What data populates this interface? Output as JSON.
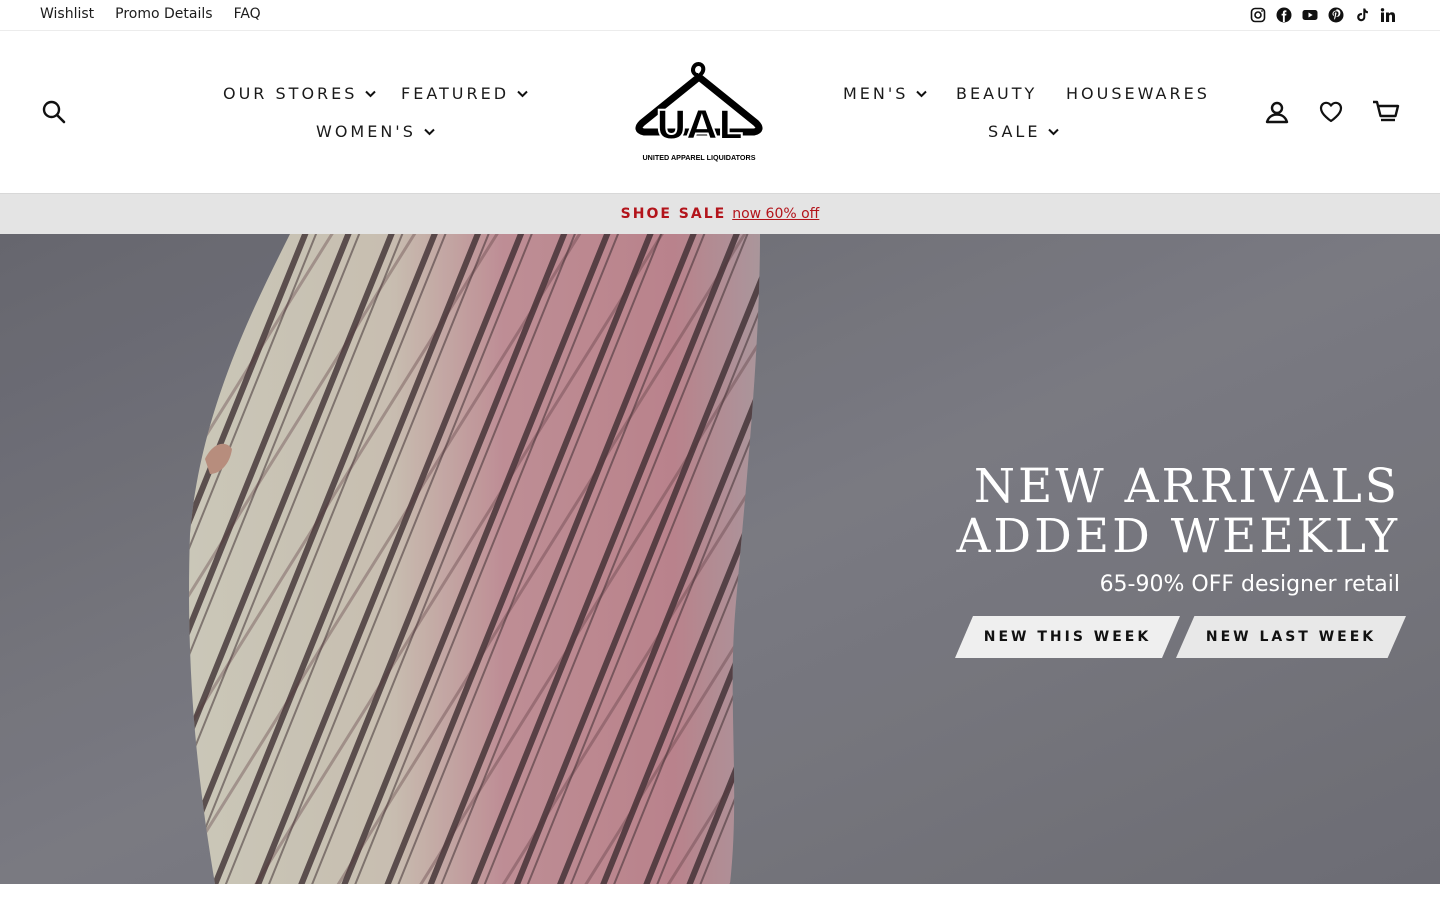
{
  "utility": {
    "links": [
      "Wishlist",
      "Promo Details",
      "FAQ"
    ],
    "social_icons": [
      "instagram-icon",
      "facebook-icon",
      "youtube-icon",
      "pinterest-icon",
      "tiktok-icon",
      "linkedin-icon"
    ]
  },
  "header": {
    "nav_left": [
      "OUR STORES",
      "FEATURED",
      "WOMEN'S"
    ],
    "nav_right": [
      "MEN'S",
      "BEAUTY",
      "HOUSEWARES",
      "SALE"
    ],
    "logo_text": "UAL",
    "logo_caption": "UNITED APPAREL LIQUIDATORS",
    "icons": [
      "search-icon",
      "account-icon",
      "wishlist-heart-icon",
      "cart-icon"
    ]
  },
  "announcement": {
    "strong": "SHOE SALE",
    "link": "now 60% off"
  },
  "hero": {
    "title_line1": "NEW ARRIVALS",
    "title_line2": "ADDED WEEKLY",
    "subtitle": "65-90% OFF designer retail",
    "button1": "NEW THIS WEEK",
    "button2": "NEW LAST WEEK"
  },
  "colors": {
    "accent_red": "#b3141b",
    "announce_bg": "#e4e4e4",
    "hero_bg": "#7d7d85"
  }
}
